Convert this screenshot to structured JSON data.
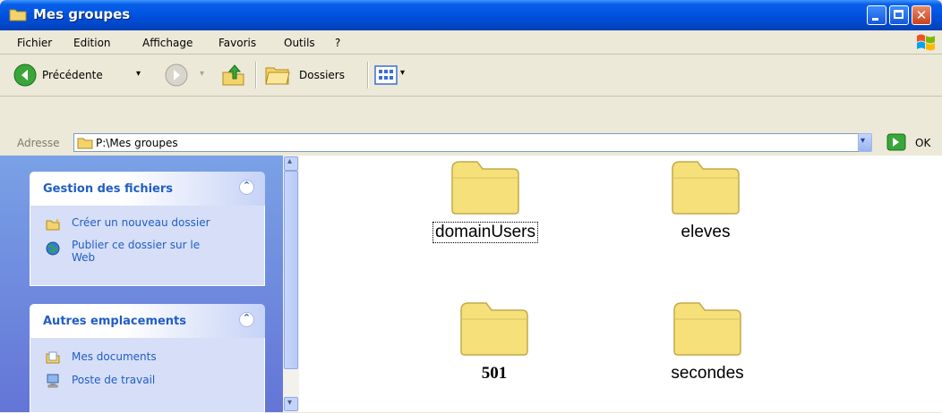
{
  "window": {
    "title": "Mes groupes"
  },
  "menu": [
    {
      "label": "Fichier"
    },
    {
      "label": "Edition"
    },
    {
      "label": "Affichage"
    },
    {
      "label": "Favoris"
    },
    {
      "label": "Outils"
    },
    {
      "label": "?"
    }
  ],
  "toolbar": {
    "back_label": "Précédente",
    "folders_label": "Dossiers"
  },
  "address": {
    "label": "Adresse",
    "path": "P:\\Mes groupes",
    "go_label": "OK"
  },
  "taskpane": {
    "file_tasks": {
      "title": "Gestion des fichiers",
      "items": [
        {
          "label": "Créer un nouveau dossier",
          "icon": "new-folder-icon"
        },
        {
          "label": "Publier ce dossier sur le Web",
          "icon": "publish-web-icon"
        }
      ]
    },
    "other_places": {
      "title": "Autres emplacements",
      "items": [
        {
          "label": "Mes documents",
          "icon": "my-documents-icon"
        },
        {
          "label": "Poste de travail",
          "icon": "my-computer-icon"
        }
      ]
    }
  },
  "folders": [
    {
      "name": "domainUsers",
      "selected": true
    },
    {
      "name": "eleves",
      "selected": false
    },
    {
      "name": "501",
      "selected": false
    },
    {
      "name": "secondes",
      "selected": false
    }
  ],
  "colors": {
    "title_bar": "#0054e3",
    "task_link": "#215dc6",
    "folder_fill": "#f5e07a"
  }
}
